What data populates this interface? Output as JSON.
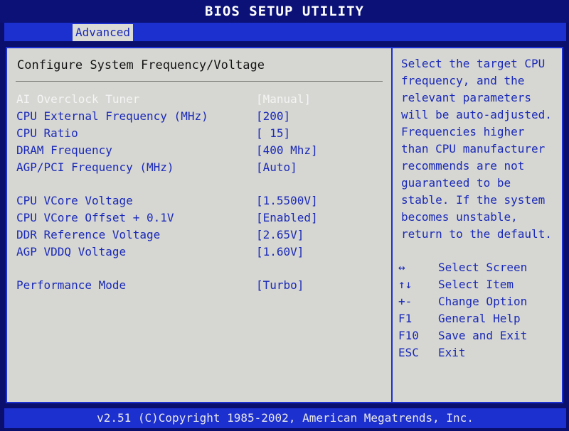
{
  "title_bar": {
    "text": "BIOS SETUP UTILITY"
  },
  "menu": {
    "tabs": [
      {
        "label": "Advanced",
        "active": true
      }
    ]
  },
  "section": {
    "title": "Configure System Frequency/Voltage"
  },
  "settings": [
    {
      "label": "AI Overclock Tuner",
      "value": "[Manual]",
      "selected": true
    },
    {
      "label": "CPU External Frequency (MHz)",
      "value": "[200]"
    },
    {
      "label": "CPU Ratio",
      "value": "[ 15]"
    },
    {
      "label": "DRAM Frequency",
      "value": "[400 Mhz]"
    },
    {
      "label": "AGP/PCI Frequency (MHz)",
      "value": "[Auto]"
    },
    {
      "label": "CPU VCore Voltage",
      "value": "[1.5500V]"
    },
    {
      "label": "CPU VCore Offset + 0.1V",
      "value": "[Enabled]"
    },
    {
      "label": "DDR Reference Voltage",
      "value": "[2.65V]"
    },
    {
      "label": "AGP VDDQ Voltage",
      "value": "[1.60V]"
    },
    {
      "label": "Performance Mode",
      "value": "[Turbo]"
    }
  ],
  "help": {
    "lines": [
      "Select the target CPU",
      "frequency, and the",
      "relevant parameters",
      "will be auto-adjusted.",
      "Frequencies higher",
      "than CPU manufacturer",
      "recommends are not",
      "guaranteed to be",
      "stable. If the system",
      "becomes unstable,",
      "return to the default."
    ]
  },
  "keys": [
    {
      "key": "↔",
      "action": "Select Screen",
      "icon": "left-right-arrow-icon"
    },
    {
      "key": "↑↓",
      "action": "Select Item",
      "icon": "up-down-arrow-icon"
    },
    {
      "key": "+-",
      "action": "Change Option"
    },
    {
      "key": "F1",
      "action": "General Help"
    },
    {
      "key": "F10",
      "action": "Save and Exit"
    },
    {
      "key": "ESC",
      "action": "Exit"
    }
  ],
  "footer": {
    "text": "v2.51 (C)Copyright 1985-2002, American Megatrends, Inc."
  },
  "colors": {
    "screen_bg": "#0a0f6e",
    "bar_blue": "#1c2fcf",
    "panel_grey": "#d6d6d2",
    "text_blue": "#1a2ab8",
    "selected_text": "#f4f4f4"
  }
}
